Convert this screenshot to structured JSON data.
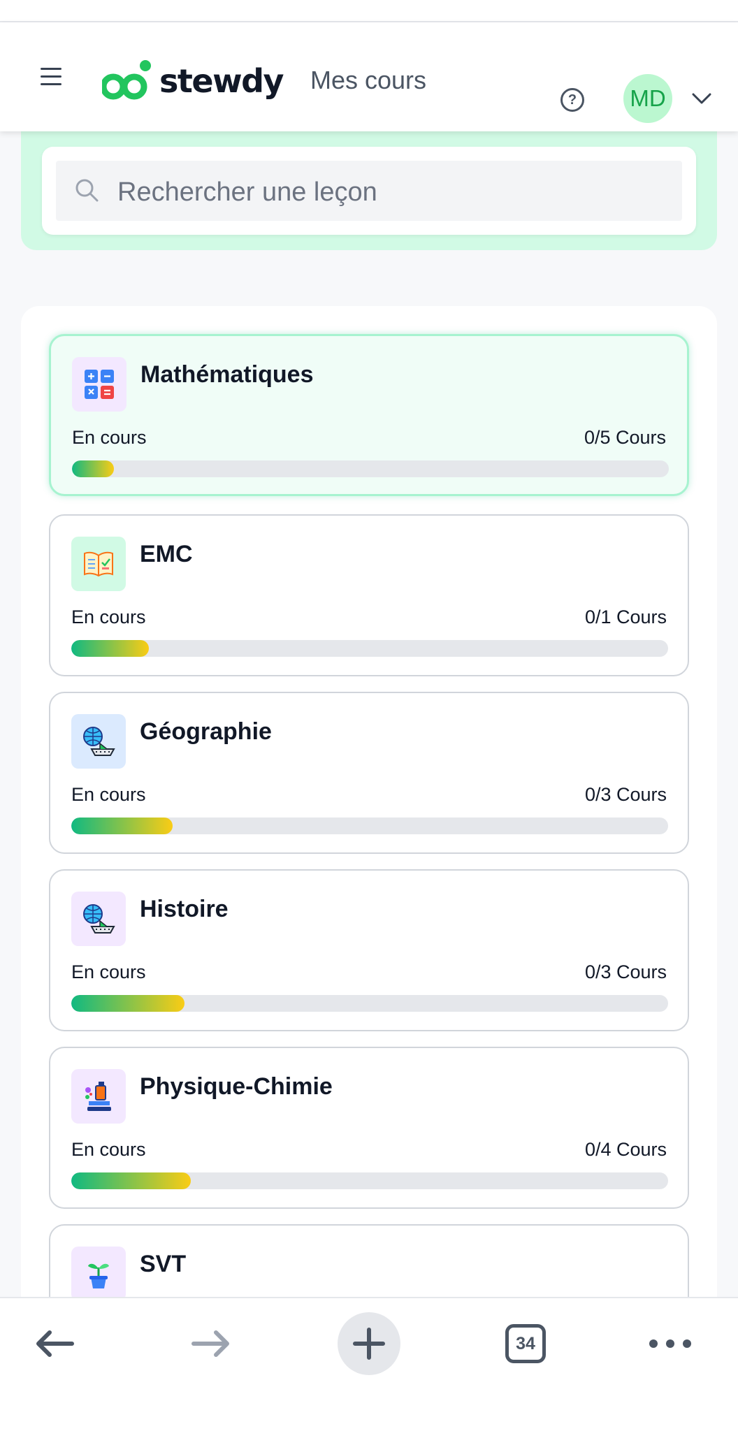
{
  "header": {
    "logo_text": "stewdy",
    "page_title": "Mes cours",
    "help_glyph": "?",
    "avatar_initials": "MD",
    "brand_color": "#22c55e"
  },
  "search": {
    "placeholder": "Rechercher une leçon"
  },
  "courses": [
    {
      "name": "Mathématiques",
      "status": "En cours",
      "count": "0/5 Cours",
      "icon": "calculator-icon",
      "progress": 0.07,
      "active": true
    },
    {
      "name": "EMC",
      "status": "En cours",
      "count": "0/1 Cours",
      "icon": "open-book-icon",
      "progress": 0.13,
      "active": false
    },
    {
      "name": "Géographie",
      "status": "En cours",
      "count": "0/3 Cours",
      "icon": "globe-ship-icon",
      "progress": 0.17,
      "active": false
    },
    {
      "name": "Histoire",
      "status": "En cours",
      "count": "0/3 Cours",
      "icon": "globe-ship-icon",
      "progress": 0.19,
      "active": false
    },
    {
      "name": "Physique-Chimie",
      "status": "En cours",
      "count": "0/4 Cours",
      "icon": "microscope-icon",
      "progress": 0.2,
      "active": false
    },
    {
      "name": "SVT",
      "status": "",
      "count": "",
      "icon": "plant-icon",
      "progress": null,
      "active": false
    }
  ],
  "bottom_nav": {
    "tab_count": "34",
    "items": [
      "back-arrow-icon",
      "forward-arrow-icon",
      "plus-icon",
      "tabs-icon",
      "more-icon"
    ]
  }
}
